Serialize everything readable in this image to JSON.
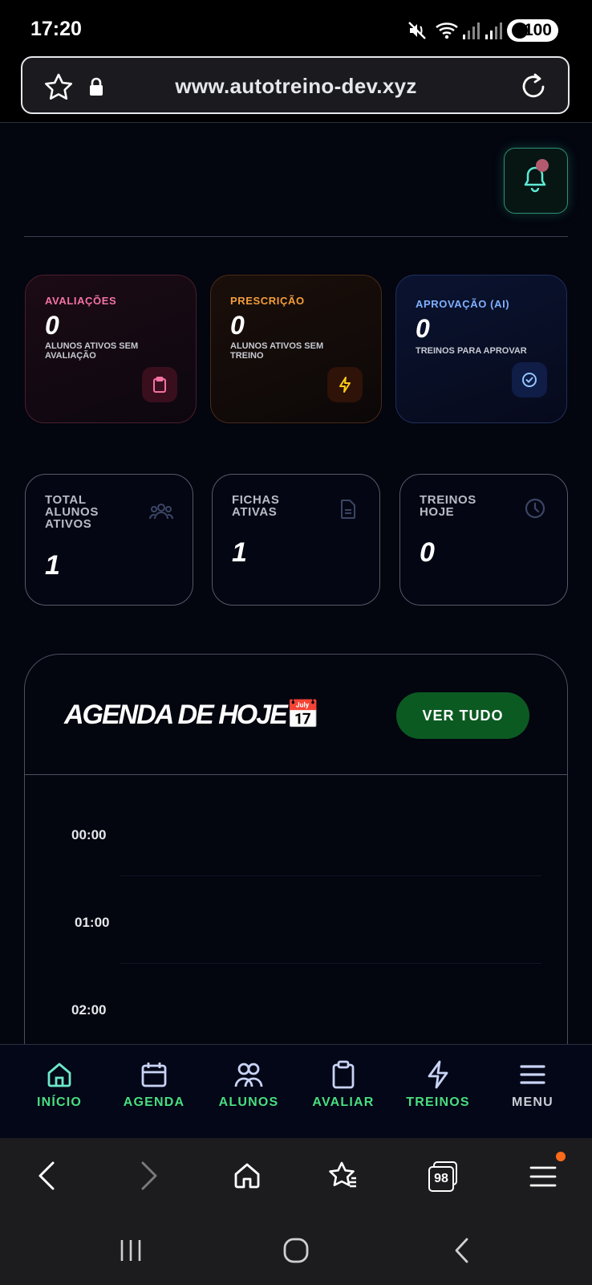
{
  "status_bar": {
    "time": "17:20",
    "battery": "100",
    "icons": [
      "mute-icon",
      "wifi-icon",
      "signal-icon",
      "signal-icon",
      "battery-saver-icon"
    ]
  },
  "browser": {
    "url": "www.autotreino-dev.xyz",
    "icons": [
      "star-icon",
      "lock-icon",
      "reload-icon"
    ]
  },
  "cards": [
    {
      "label": "AVALIAÇÕES",
      "value": "0",
      "sub1": "ALUNOS ATIVOS SEM",
      "sub2": "AVALIAÇÃO",
      "icon": "clipboard-icon",
      "color": "#f472a6"
    },
    {
      "label": "PRESCRIÇÃO",
      "value": "0",
      "sub1": "ALUNOS ATIVOS SEM",
      "sub2": "TREINO",
      "icon": "lightning-icon",
      "color": "#f59e3b"
    },
    {
      "label": "APROVAÇÃO (AI)",
      "value": "0",
      "sub1": "TREINOS PARA APROVAR",
      "sub2": "",
      "icon": "check-circle-icon",
      "color": "#7fb0ff"
    }
  ],
  "stats": [
    {
      "line1": "TOTAL",
      "line2": "ALUNOS",
      "line3": "ATIVOS",
      "value": "1",
      "icon": "users-icon"
    },
    {
      "line1": "FICHAS",
      "line2": "ATIVAS",
      "line3": "",
      "value": "1",
      "icon": "document-icon"
    },
    {
      "line1": "TREINOS",
      "line2": "HOJE",
      "line3": "",
      "value": "0",
      "icon": "clock-icon"
    }
  ],
  "agenda": {
    "title": "AGENDA DE HOJE",
    "emoji": "📅",
    "button": "VER TUDO",
    "hours": [
      "00:00",
      "01:00",
      "02:00"
    ]
  },
  "nav": [
    {
      "label": "INÍCIO",
      "icon": "home-icon",
      "active": true
    },
    {
      "label": "AGENDA",
      "icon": "calendar-icon"
    },
    {
      "label": "ALUNOS",
      "icon": "users-icon"
    },
    {
      "label": "AVALIAR",
      "icon": "clipboard-icon"
    },
    {
      "label": "TREINOS",
      "icon": "lightning-icon"
    },
    {
      "label": "MENU",
      "icon": "hamburger-icon"
    }
  ],
  "browser_nav": {
    "tabs_count": "98"
  },
  "colors": {
    "accent_green": "#4ade80",
    "nav_active": "#6ee7c9",
    "menu_gray": "#c9cdd6"
  }
}
